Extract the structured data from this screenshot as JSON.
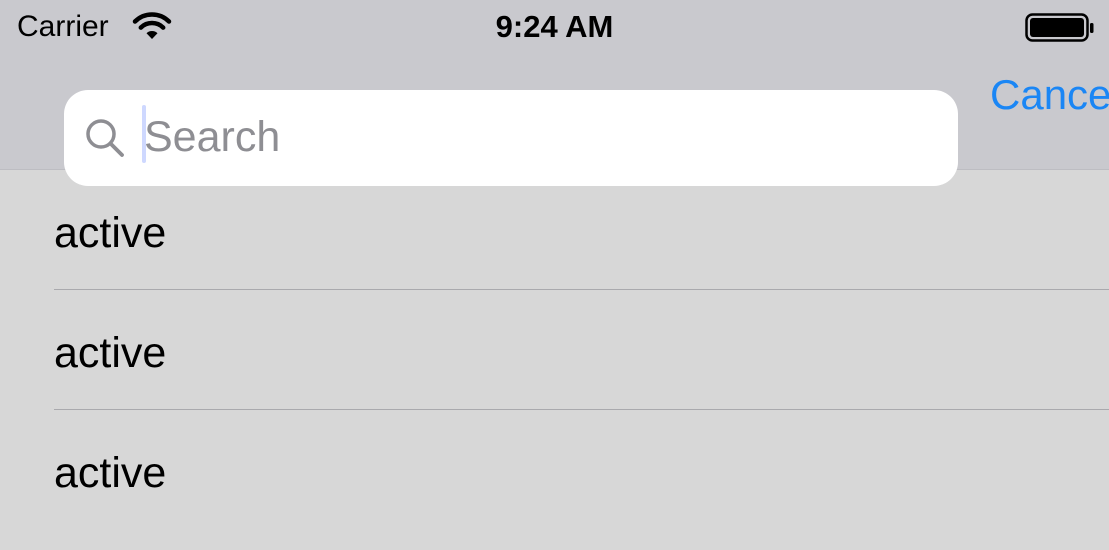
{
  "status_bar": {
    "carrier": "Carrier",
    "time": "9:24 AM",
    "wifi_icon": "wifi-icon",
    "battery_icon": "battery-full-icon"
  },
  "search": {
    "placeholder": "Search",
    "value": "",
    "icon": "search-icon",
    "cancel_label": "Cance"
  },
  "results": {
    "items": [
      {
        "label": "active"
      },
      {
        "label": "active"
      },
      {
        "label": "active"
      }
    ]
  },
  "colors": {
    "accent": "#1a86f5",
    "nav_background": "#c9c9ce",
    "list_background": "#d7d7d7"
  }
}
